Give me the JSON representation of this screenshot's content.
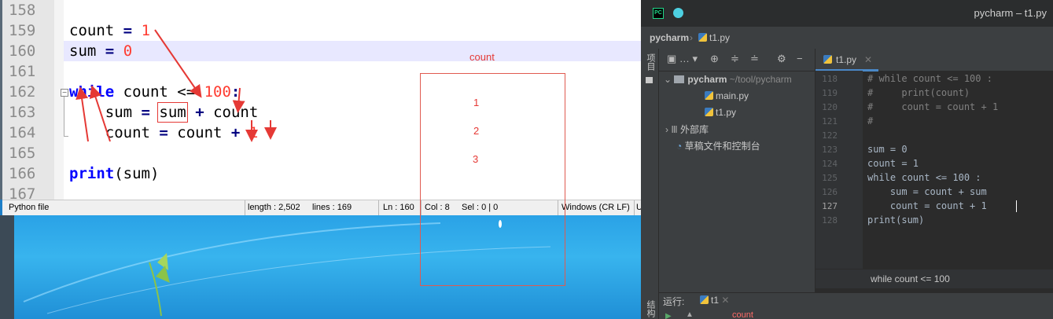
{
  "npp": {
    "line_numbers": [
      "158",
      "159",
      "160",
      "161",
      "162",
      "163",
      "164",
      "165",
      "166",
      "167"
    ],
    "code": {
      "l159_var": "count",
      "l159_op": "=",
      "l159_val": "1",
      "l160_var": "sum",
      "l160_op": "=",
      "l160_val": "0",
      "l162_kw": "while",
      "l162_rest": " count <= ",
      "l162_num": "100",
      "l162_colon": ":",
      "l163_a": "    sum ",
      "l163_eq": "=",
      "l163_sum": "sum",
      "l163_plus": " + ",
      "l163_count": "count",
      "l164_a": "    count ",
      "l164_eq": "=",
      "l164_b": " count ",
      "l164_plus": "+",
      "l164_num": "1",
      "l166_kw": "print",
      "l166_rest": "(sum)"
    },
    "status": {
      "file_type": "Python file",
      "length": "length : 2,502",
      "lines": "lines : 169",
      "ln": "Ln : 160",
      "col": "Col : 8",
      "sel": "Sel : 0 | 0",
      "eol": "Windows (CR LF)",
      "enc": "U"
    }
  },
  "annotation": {
    "label": "count",
    "values": [
      "1",
      "2",
      "3"
    ]
  },
  "pycharm": {
    "title": "pycharm – t1.py",
    "breadcrumb_project": "pycharm",
    "breadcrumb_file": "t1.py",
    "side_tool_project": "项目",
    "side_tool_structure": "结构",
    "project_tree": {
      "root": "pycharm",
      "root_path": "~/tool/pycharm",
      "files": [
        "main.py",
        "t1.py"
      ],
      "external": "外部库",
      "scratches": "草稿文件和控制台"
    },
    "tab_label": "t1.py",
    "line_numbers": [
      "118",
      "119",
      "120",
      "121",
      "122",
      "123",
      "124",
      "125",
      "126",
      "127",
      "128"
    ],
    "code_lines": [
      "# while count <= 100 :",
      "#     print(count)",
      "#     count = count + 1",
      "#",
      "",
      "sum = 0",
      "count = 1",
      "while count <= 100 :",
      "    sum = count + sum",
      "    count = count + 1",
      "print(sum)"
    ],
    "crumb": "while count <= 100",
    "run_label": "运行:",
    "run_tab": "t1",
    "run_output": "count"
  },
  "colors": {
    "annotation_red": "#e53935",
    "pycharm_bg": "#2b2b2b",
    "npp_keyword": "#0000ff"
  }
}
